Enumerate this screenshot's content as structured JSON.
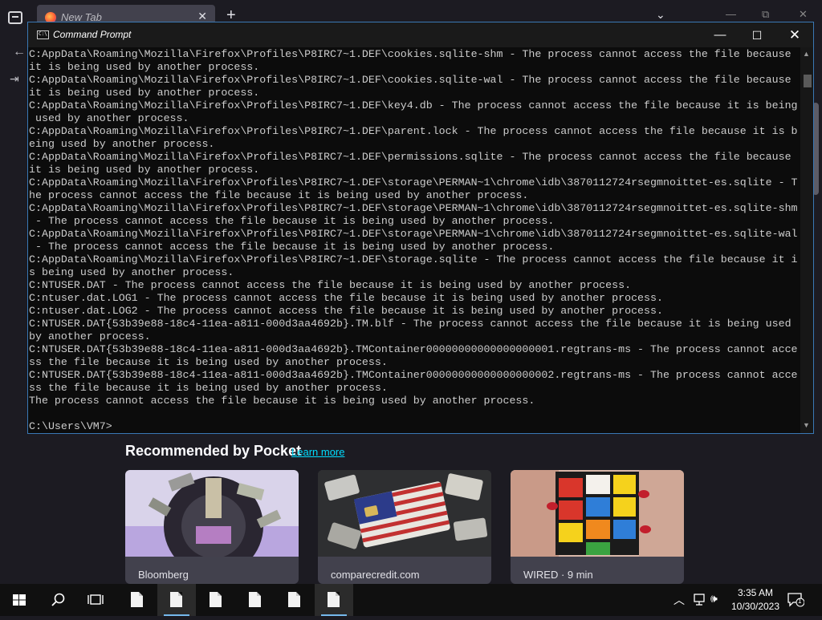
{
  "browser": {
    "tab_title": "New Tab",
    "tab_close": "✕",
    "new_tab": "+",
    "list_tabs": "⌄",
    "minimize": "—",
    "restore": "⧉",
    "close": "✕"
  },
  "cmd": {
    "title": "Command Prompt",
    "lines": [
      "C:AppData\\Roaming\\Mozilla\\Firefox\\Profiles\\P8IRC7~1.DEF\\cookies.sqlite-shm - The process cannot access the file because",
      "it is being used by another process.",
      "C:AppData\\Roaming\\Mozilla\\Firefox\\Profiles\\P8IRC7~1.DEF\\cookies.sqlite-wal - The process cannot access the file because",
      "it is being used by another process.",
      "C:AppData\\Roaming\\Mozilla\\Firefox\\Profiles\\P8IRC7~1.DEF\\key4.db - The process cannot access the file because it is being",
      " used by another process.",
      "C:AppData\\Roaming\\Mozilla\\Firefox\\Profiles\\P8IRC7~1.DEF\\parent.lock - The process cannot access the file because it is b",
      "eing used by another process.",
      "C:AppData\\Roaming\\Mozilla\\Firefox\\Profiles\\P8IRC7~1.DEF\\permissions.sqlite - The process cannot access the file because",
      "it is being used by another process.",
      "C:AppData\\Roaming\\Mozilla\\Firefox\\Profiles\\P8IRC7~1.DEF\\storage\\PERMAN~1\\chrome\\idb\\3870112724rsegmnoittet-es.sqlite - T",
      "he process cannot access the file because it is being used by another process.",
      "C:AppData\\Roaming\\Mozilla\\Firefox\\Profiles\\P8IRC7~1.DEF\\storage\\PERMAN~1\\chrome\\idb\\3870112724rsegmnoittet-es.sqlite-shm",
      " - The process cannot access the file because it is being used by another process.",
      "C:AppData\\Roaming\\Mozilla\\Firefox\\Profiles\\P8IRC7~1.DEF\\storage\\PERMAN~1\\chrome\\idb\\3870112724rsegmnoittet-es.sqlite-wal",
      " - The process cannot access the file because it is being used by another process.",
      "C:AppData\\Roaming\\Mozilla\\Firefox\\Profiles\\P8IRC7~1.DEF\\storage.sqlite - The process cannot access the file because it i",
      "s being used by another process.",
      "C:NTUSER.DAT - The process cannot access the file because it is being used by another process.",
      "C:ntuser.dat.LOG1 - The process cannot access the file because it is being used by another process.",
      "C:ntuser.dat.LOG2 - The process cannot access the file because it is being used by another process.",
      "C:NTUSER.DAT{53b39e88-18c4-11ea-a811-000d3aa4692b}.TM.blf - The process cannot access the file because it is being used",
      "by another process.",
      "C:NTUSER.DAT{53b39e88-18c4-11ea-a811-000d3aa4692b}.TMContainer00000000000000000001.regtrans-ms - The process cannot acce",
      "ss the file because it is being used by another process.",
      "C:NTUSER.DAT{53b39e88-18c4-11ea-a811-000d3aa4692b}.TMContainer00000000000000000002.regtrans-ms - The process cannot acce",
      "ss the file because it is being used by another process.",
      "The process cannot access the file because it is being used by another process.",
      "",
      "C:\\Users\\VM7>"
    ]
  },
  "pocket": {
    "heading": "Recommended by Pocket",
    "learn_more": "Learn more",
    "cards": [
      {
        "source": "Bloomberg"
      },
      {
        "source": "comparecredit.com"
      },
      {
        "source": "WIRED · 9 min"
      }
    ]
  },
  "taskbar": {
    "time": "3:35 AM",
    "date": "10/30/2023",
    "notification_count": "1"
  }
}
